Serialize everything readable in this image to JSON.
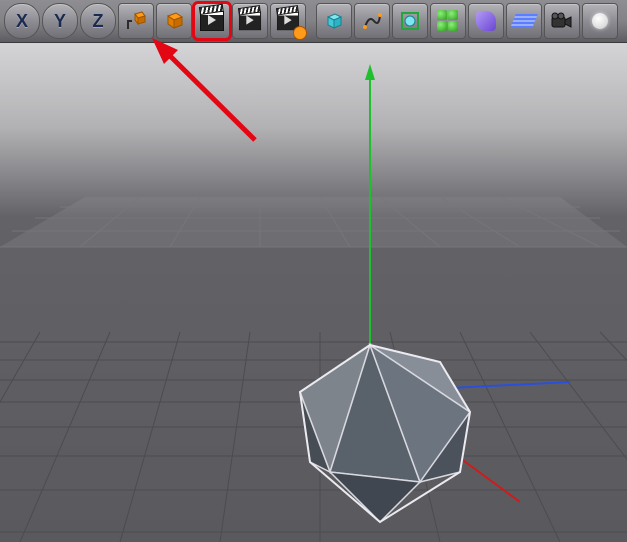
{
  "toolbar": {
    "axis": {
      "x": "X",
      "y": "Y",
      "z": "Z"
    },
    "buttons": [
      {
        "name": "axis-x"
      },
      {
        "name": "axis-y"
      },
      {
        "name": "axis-z"
      },
      {
        "name": "parent-to-icon"
      },
      {
        "name": "make-editable-icon"
      },
      {
        "name": "render-view-icon",
        "highlighted": true
      },
      {
        "name": "render-picture-viewer-icon"
      },
      {
        "name": "render-settings-icon"
      },
      {
        "name": "separator"
      },
      {
        "name": "primitive-cube-icon"
      },
      {
        "name": "spline-pen-icon"
      },
      {
        "name": "generator-subdiv-icon"
      },
      {
        "name": "generator-array-icon"
      },
      {
        "name": "deformer-icon"
      },
      {
        "name": "floor-icon"
      },
      {
        "name": "camera-icon"
      },
      {
        "name": "light-icon"
      }
    ]
  },
  "viewport": {
    "axes": {
      "x_color": "#d11a1a",
      "y_color": "#1fbf2f",
      "z_color": "#2b4fd8"
    },
    "object": "icosahedron"
  },
  "annotation": {
    "present": true,
    "color": "#e30613",
    "target": "render-view-icon"
  }
}
